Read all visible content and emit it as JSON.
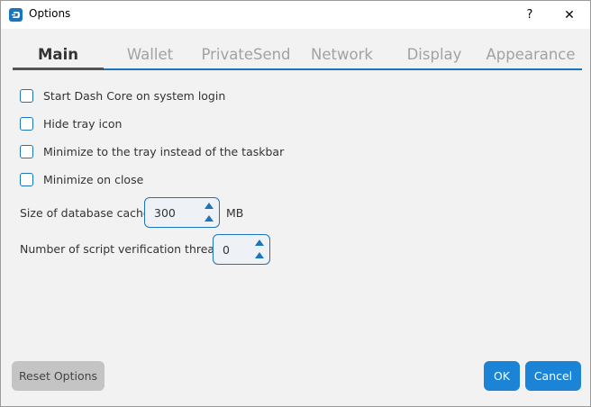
{
  "window": {
    "title": "Options",
    "help_label": "?",
    "close_label": "✕"
  },
  "tabs": [
    {
      "label": "Main",
      "active": true
    },
    {
      "label": "Wallet",
      "active": false
    },
    {
      "label": "PrivateSend",
      "active": false
    },
    {
      "label": "Network",
      "active": false
    },
    {
      "label": "Display",
      "active": false
    },
    {
      "label": "Appearance",
      "active": false
    }
  ],
  "options": [
    {
      "label": "Start Dash Core on system login",
      "checked": false
    },
    {
      "label": "Hide tray icon",
      "checked": false
    },
    {
      "label": "Minimize to the tray instead of the taskbar",
      "checked": false
    },
    {
      "label": "Minimize on close",
      "checked": false
    }
  ],
  "db_cache": {
    "label": "Size of database cache",
    "value": "300",
    "unit": "MB"
  },
  "threads": {
    "label": "Number of script verification threads",
    "value": "0"
  },
  "buttons": {
    "reset": "Reset Options",
    "ok": "OK",
    "cancel": "Cancel"
  },
  "colors": {
    "accent": "#1c75bc",
    "button_blue": "#1c84d6",
    "background": "#f2f2f2"
  },
  "icons": {
    "app": "dash-logo-icon",
    "close": "close-icon",
    "help": "help-icon"
  }
}
